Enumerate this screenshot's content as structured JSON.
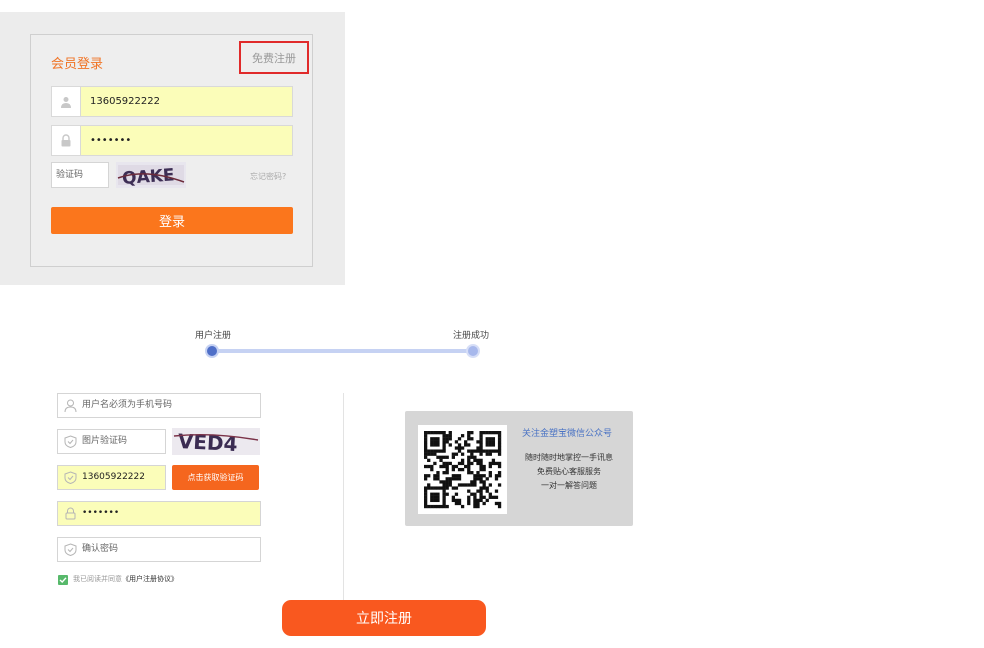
{
  "login": {
    "title": "会员登录",
    "register_link": "免费注册",
    "phone_value": "13605922222",
    "password_value": "•••••••",
    "captcha_placeholder": "验证码",
    "captcha_text": "QAKE",
    "forgot_link": "忘记密码?",
    "login_button": "登录"
  },
  "steps": {
    "step1": "用户注册",
    "step2": "注册成功"
  },
  "register": {
    "username_placeholder": "用户名必须为手机号码",
    "captcha_placeholder": "图片验证码",
    "captcha_text": "VED4",
    "phone_value": "13605922222",
    "sms_button": "点击获取验证码",
    "password_value": "•••••••",
    "confirm_placeholder": "确认密码",
    "agree_prefix": "我已阅读并同意",
    "agree_link": "《用户注册协议》",
    "submit_button": "立即注册"
  },
  "qr": {
    "title": "关注金塑宝微信公众号",
    "line1": "随时随时地掌控一手讯息",
    "line2": "免费贴心客服服务",
    "line3": "一对一解答问题"
  },
  "colors": {
    "accent_orange": "#fb761c",
    "link_blue": "#4a73c4",
    "autofill_yellow": "#fbfdb9",
    "check_green": "#57b96b"
  }
}
